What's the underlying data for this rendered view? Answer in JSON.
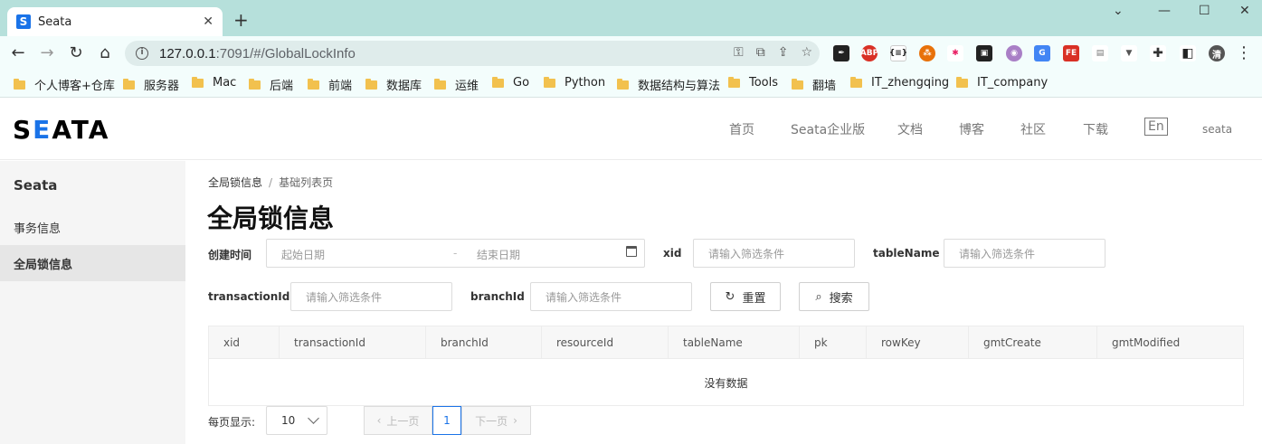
{
  "browser": {
    "tab_title": "Seata",
    "tab_favicon": "S",
    "url_host": "127.0.0.1",
    "url_rest": ":7091/#/GlobalLockInfo",
    "profile_initial": "清"
  },
  "bookmarks": [
    "个人博客+仓库",
    "服务器",
    "Mac",
    "后端",
    "前端",
    "数据库",
    "运维",
    "Go",
    "Python",
    "数据结构与算法",
    "Tools",
    "翻墙",
    "IT_zhengqing",
    "IT_company"
  ],
  "site": {
    "logo_1": "S",
    "logo_2": "E",
    "logo_3": "ATA",
    "nav": [
      "首页",
      "Seata企业版",
      "文档",
      "博客",
      "社区",
      "下载"
    ],
    "lang": "En",
    "user": "seata"
  },
  "sidebar": {
    "title": "Seata",
    "items": [
      {
        "label": "事务信息"
      },
      {
        "label": "全局锁信息"
      }
    ]
  },
  "main": {
    "breadcrumb": {
      "parent": "全局锁信息",
      "sep": "/",
      "current": "基础列表页"
    },
    "title": "全局锁信息",
    "filters": {
      "created_label": "创建时间",
      "start_placeholder": "起始日期",
      "range_sep": "-",
      "end_placeholder": "结束日期",
      "xid_label": "xid",
      "xid_placeholder": "请输入筛选条件",
      "table_label": "tableName",
      "table_placeholder": "请输入筛选条件",
      "tx_label": "transactionId",
      "tx_placeholder": "请输入筛选条件",
      "branch_label": "branchId",
      "branch_placeholder": "请输入筛选条件",
      "reset": "重置",
      "search": "搜索"
    },
    "table": {
      "columns": [
        "xid",
        "transactionId",
        "branchId",
        "resourceId",
        "tableName",
        "pk",
        "rowKey",
        "gmtCreate",
        "gmtModified"
      ],
      "empty": "没有数据"
    },
    "pagination": {
      "page_size_label": "每页显示:",
      "page_size": "10",
      "prev": "上一页",
      "current": "1",
      "next": "下一页"
    }
  }
}
